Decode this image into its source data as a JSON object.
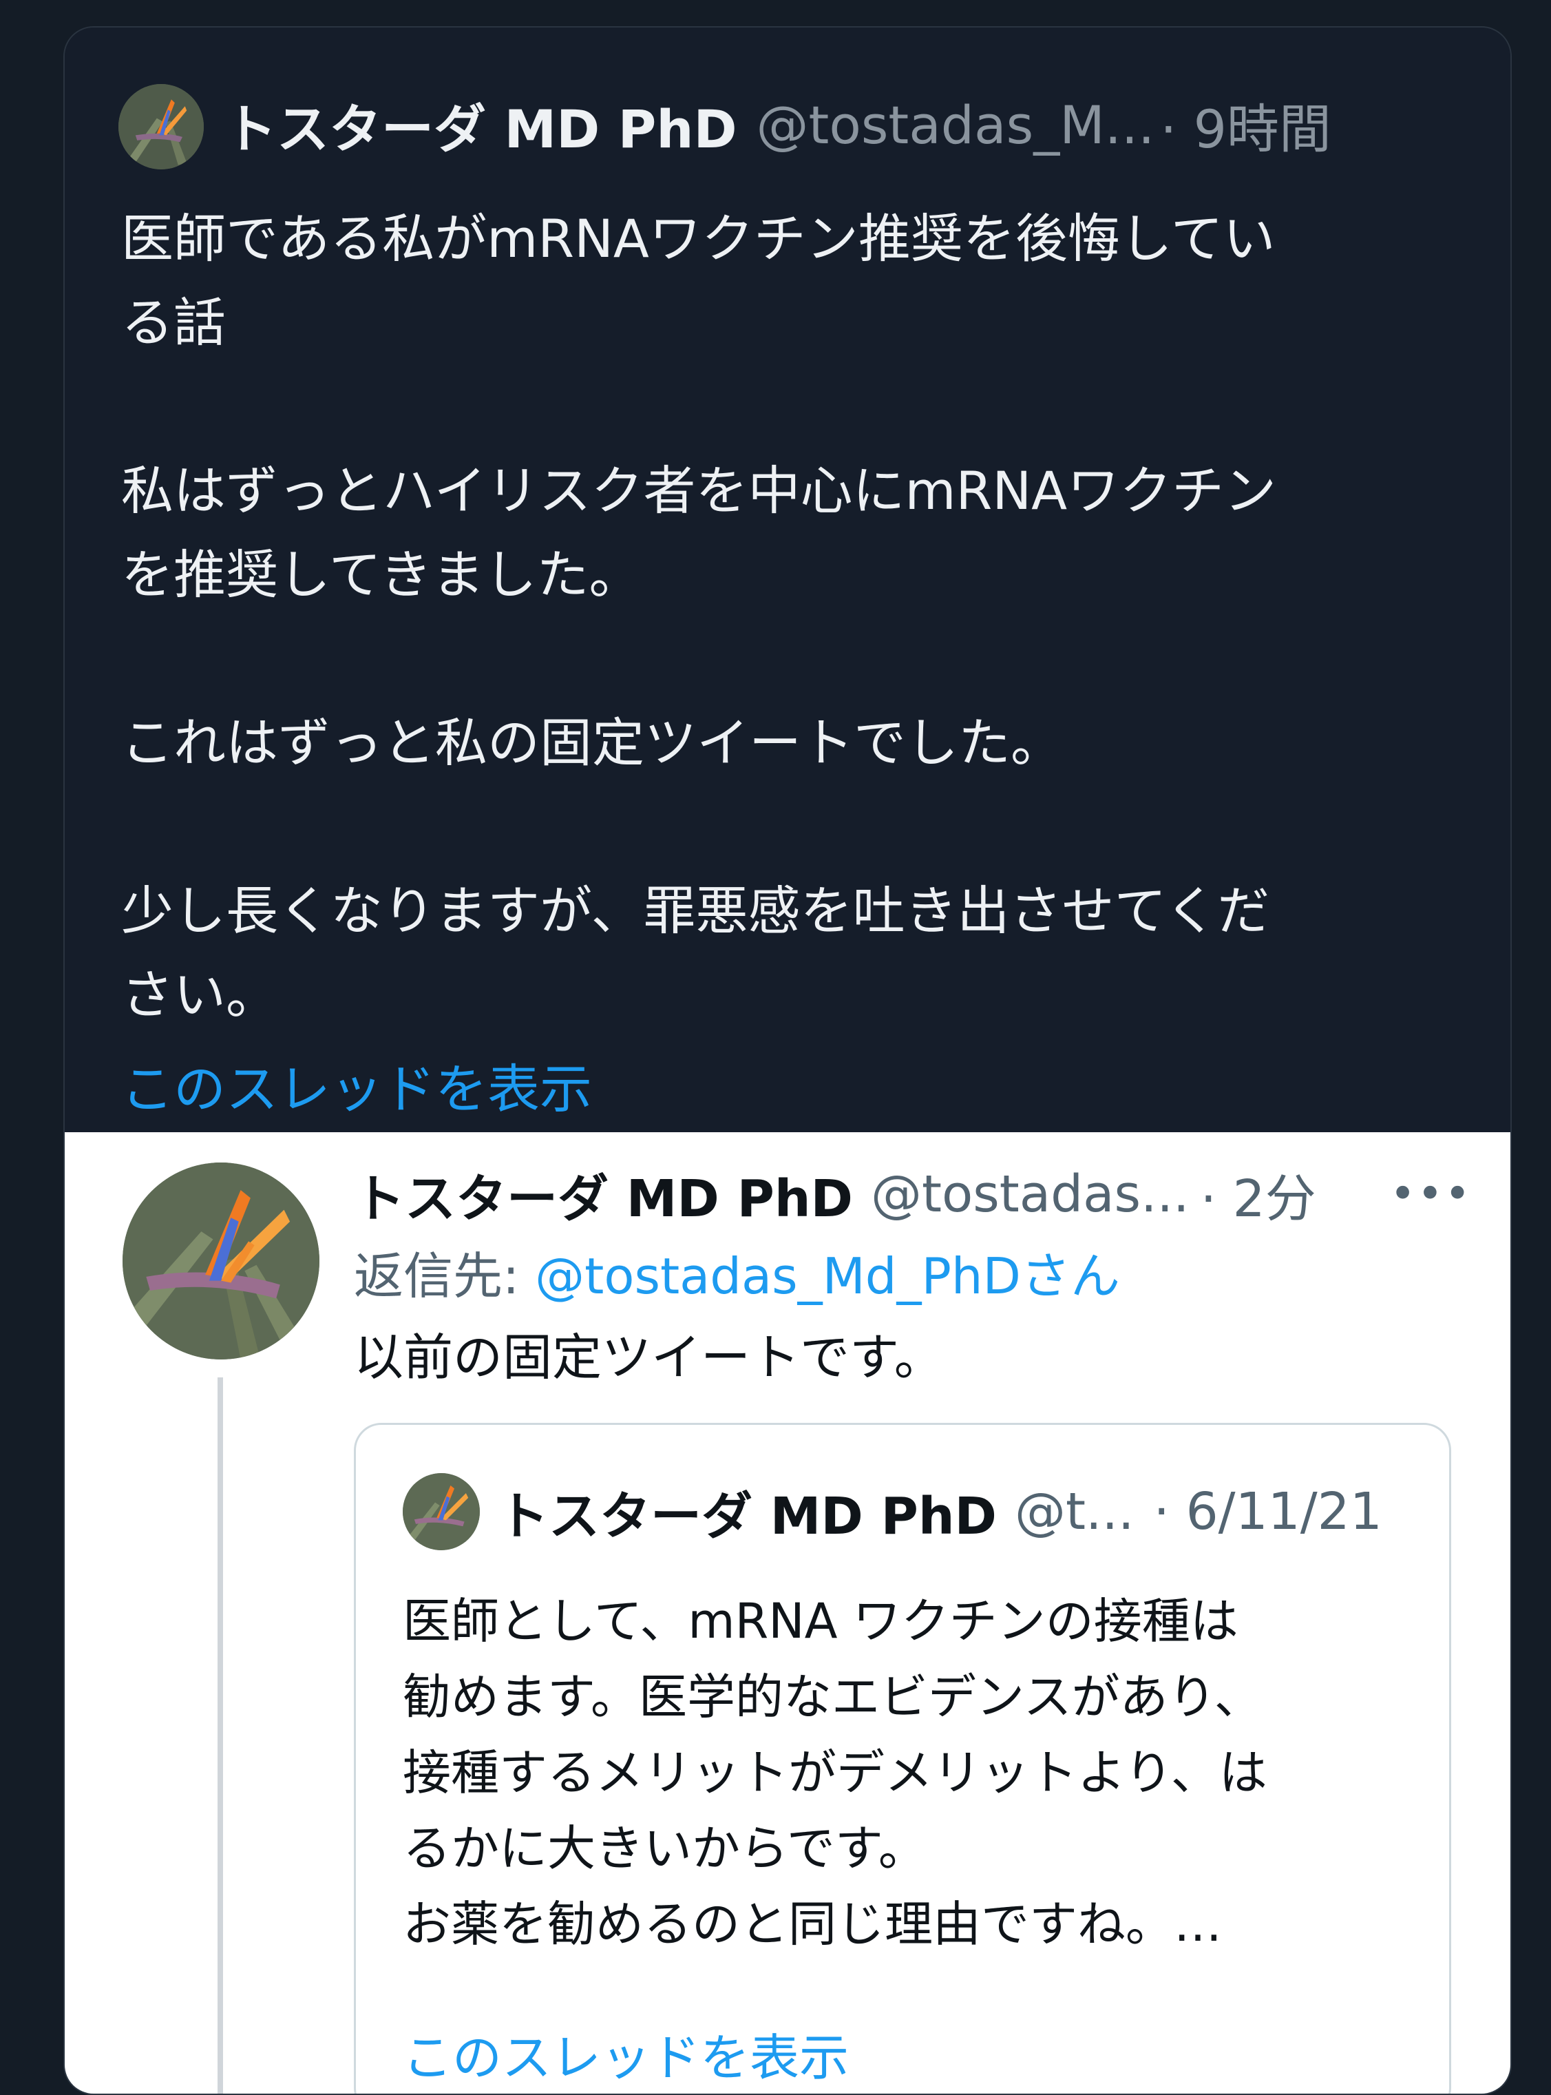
{
  "quoted_tweet": {
    "author_name": "トスターダ MD PhD",
    "handle": "@tostadas_M...",
    "time": "· 9時間",
    "paragraphs": [
      "医師である私がmRNAワクチン推奨を後悔してい\nる話",
      "私はずっとハイリスク者を中心にmRNAワクチン\nを推奨してきました。",
      "これはずっと私の固定ツイートでした。",
      "少し長くなりますが、罪悪感を吐き出させてくだ\nさい。"
    ],
    "show_thread": "このスレッドを表示"
  },
  "reply_tweet": {
    "author_name": "トスターダ MD PhD",
    "handle": "@tostadas...",
    "time": "· 2分",
    "more_label": "•••",
    "reply_to_prefix": "返信先: ",
    "reply_to_handle": "@tostadas_Md_PhDさん",
    "text": "以前の固定ツイートです。",
    "embedded_quote": {
      "author_name": "トスターダ MD PhD",
      "handle": "@t...",
      "time": "· 6/11/21",
      "lines": [
        "医師として、mRNA ワクチンの接種は",
        "勧めます。医学的なエビデンスがあり、",
        "接種するメリットがデメリットより、は",
        "るかに大きいからです。",
        "お薬を勧めるのと同じ理由ですね。…"
      ],
      "show_thread": "このスレッドを表示"
    }
  },
  "colors": {
    "dark_bg": "#151d2a",
    "link": "#1d9bf0",
    "flower_orange": "#f07a22",
    "flower_blue": "#4b6fd6"
  }
}
